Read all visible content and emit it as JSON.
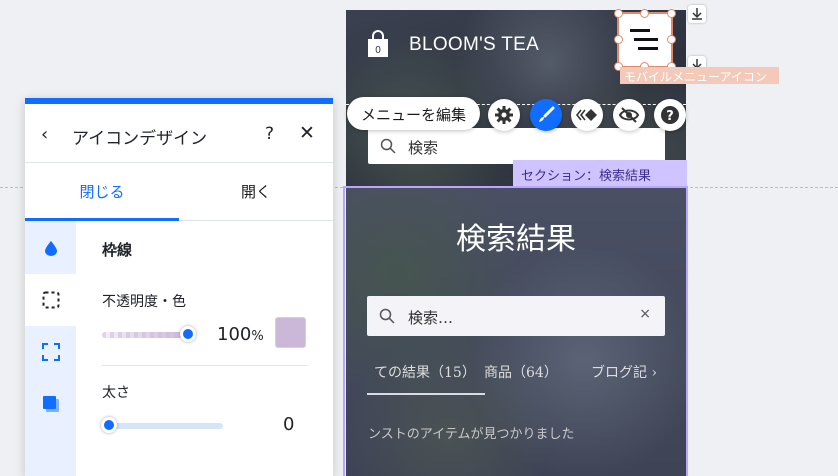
{
  "site": {
    "brand": "BLOOM'S TEA",
    "header_search_text": "検索",
    "results_title": "検索結果",
    "results_search_placeholder": "検索…",
    "results_clear": "×",
    "result_tabs": [
      "ての結果（15）",
      "商品（64）",
      "ブログ記"
    ],
    "no_results_text": "ンストのアイテムが見つかりました",
    "section_label": "セクション：検索結果",
    "mobile_menu_label": "モバイルメニューアイコン"
  },
  "toolbar": {
    "menu_edit_label": "メニューを編集",
    "icons": [
      "gear-icon",
      "brush-icon",
      "animation-icon",
      "hide-icon",
      "help-icon"
    ]
  },
  "panel": {
    "title": "アイコンデザイン",
    "help": "?",
    "close": "✕",
    "back": "‹",
    "tabs": [
      "閉じる",
      "開く"
    ],
    "section_heading": "枠線",
    "opacity_label": "不透明度・色",
    "opacity_value": "100",
    "opacity_unit": "%",
    "opacity_fraction": 1.0,
    "thickness_label": "太さ",
    "thickness_value": "0",
    "border_color": "#cbb8d8",
    "accent_color": "#116dff"
  }
}
